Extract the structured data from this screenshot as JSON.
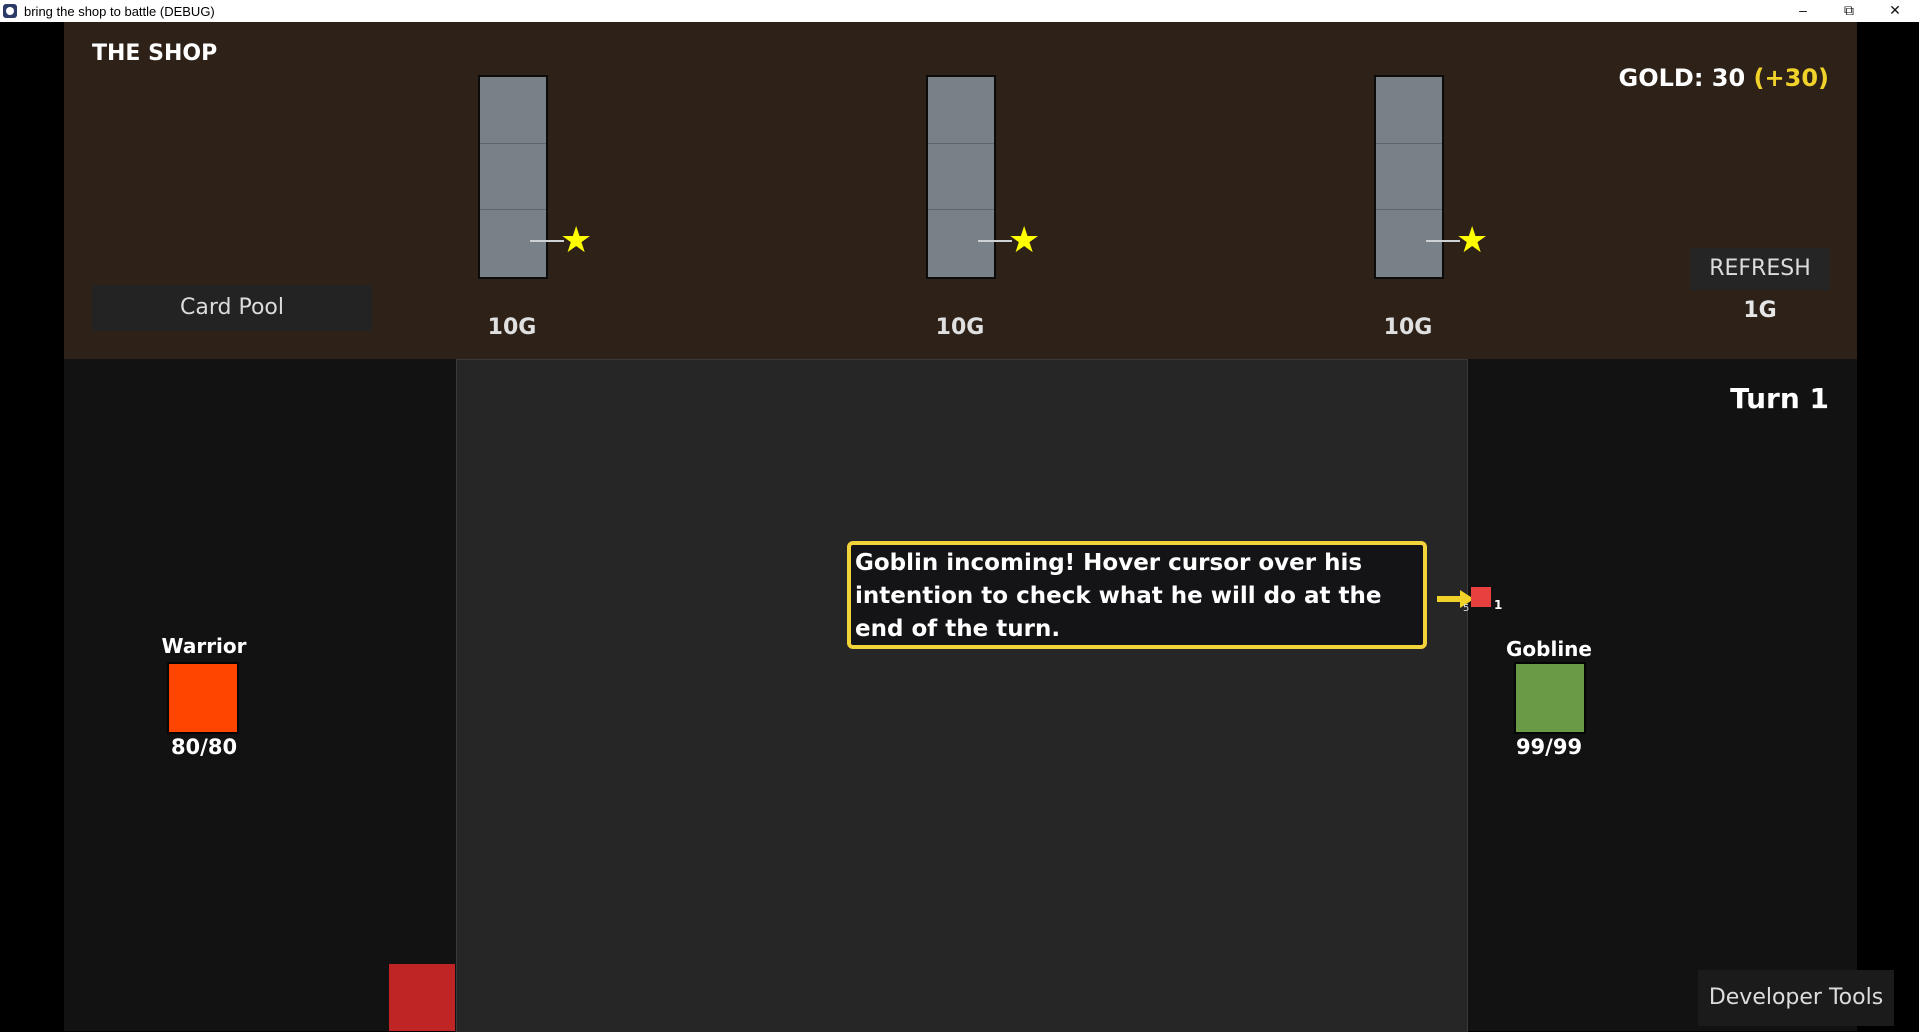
{
  "window": {
    "title": "bring the shop to battle (DEBUG)",
    "minimize_glyph": "–",
    "restore_glyph": "⧉",
    "close_glyph": "✕"
  },
  "shop": {
    "title": "THE SHOP",
    "gold_label": "GOLD: 30",
    "gold_bonus": "(+30)",
    "card_pool_label": "Card Pool",
    "refresh_label": "REFRESH",
    "refresh_cost": "1G",
    "slots": [
      {
        "price": "10G",
        "star": "★"
      },
      {
        "price": "10G",
        "star": "★"
      },
      {
        "price": "10G",
        "star": "★"
      }
    ]
  },
  "battle": {
    "turn_label": "Turn 1",
    "player": {
      "name": "Warrior",
      "hp": "80/80",
      "color": "#ff4500"
    },
    "enemy": {
      "name": "Gobline",
      "hp": "99/99",
      "color": "#6a9a45"
    },
    "intent": {
      "value": "1",
      "secondary": "5",
      "color": "#e83f3f"
    },
    "tooltip": "Goblin incoming! Hover cursor over his intention to check what he will do at the end of the turn."
  },
  "developer_tools_label": "Developer Tools",
  "colors": {
    "accent_yellow": "#f0d22a",
    "shop_bg": "#2e2118",
    "arena_bg": "#262626"
  }
}
